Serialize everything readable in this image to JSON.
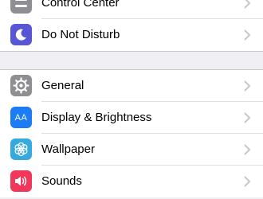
{
  "colors": {
    "background": "#efeff4",
    "cell": "#ffffff",
    "chevron": "#c7c7cc",
    "control_center_icon": "#8e8e93",
    "dnd_icon": "#5856d6",
    "general_icon": "#8e8e93",
    "display_icon": "#1b7cf5",
    "wallpaper_icon": "#36aadc",
    "sounds_icon": "#f2385a"
  },
  "settings": {
    "group1": [
      {
        "label": "Control Center",
        "icon": "switches-icon"
      },
      {
        "label": "Do Not Disturb",
        "icon": "moon-icon"
      }
    ],
    "group2": [
      {
        "label": "General",
        "icon": "gear-icon"
      },
      {
        "label": "Display & Brightness",
        "icon": "text-size-icon",
        "icon_text": "AA"
      },
      {
        "label": "Wallpaper",
        "icon": "flower-icon"
      },
      {
        "label": "Sounds",
        "icon": "speaker-icon"
      }
    ]
  }
}
